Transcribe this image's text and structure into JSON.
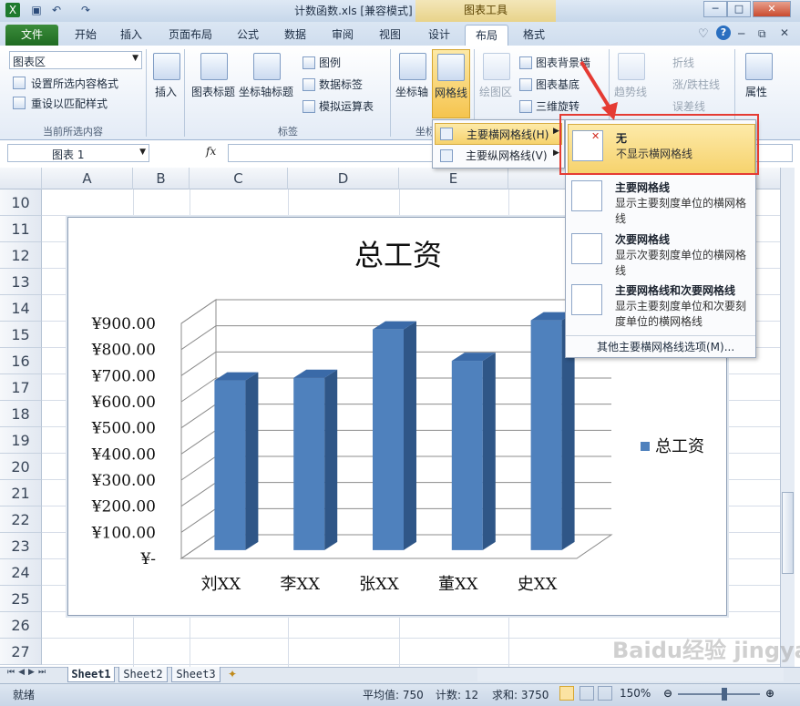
{
  "window": {
    "title": "计数函数.xls  [兼容模式]  -  Microsoft Excel",
    "context_tab": "图表工具",
    "min": "─",
    "max": "□",
    "close": "✕"
  },
  "tabs": [
    "文件",
    "开始",
    "插入",
    "页面布局",
    "公式",
    "数据",
    "审阅",
    "视图",
    "设计",
    "布局",
    "格式"
  ],
  "ribbon": {
    "current_selection": {
      "dropdown": "图表区",
      "format_selection": "设置所选内容格式",
      "reset_style": "重设以匹配样式",
      "group_label": "当前所选内容"
    },
    "insert": "插入",
    "labels_group": {
      "chart_title": "图表标题",
      "axis_titles": "坐标轴标题",
      "legend": "图例",
      "data_labels": "数据标签",
      "data_table": "模拟运算表",
      "group_label": "标签"
    },
    "axes_group": {
      "axes": "坐标轴",
      "gridlines": "网格线",
      "group_label": "坐标"
    },
    "background_group": {
      "plot_area": "绘图区",
      "chart_wall": "图表背景墙",
      "chart_floor": "图表基底",
      "rotation": "三维旋转"
    },
    "analysis_group": {
      "trendline": "趋势线",
      "lines": "折线",
      "updown_bars": "涨/跌柱线",
      "error_bars": "误差线"
    },
    "properties": "属性"
  },
  "formula_bar": {
    "name_box": "图表 1",
    "fx": "fx"
  },
  "columns": [
    "A",
    "B",
    "C",
    "D",
    "E"
  ],
  "rows": [
    "10",
    "11",
    "12",
    "13",
    "14",
    "15",
    "16",
    "17",
    "18",
    "19",
    "20",
    "21",
    "22",
    "23",
    "24",
    "25",
    "26",
    "27"
  ],
  "chart_data": {
    "type": "bar",
    "title": "总工资",
    "categories": [
      "刘XX",
      "李XX",
      "张XX",
      "董XX",
      "史XX"
    ],
    "series": [
      {
        "name": "总工资",
        "values": [
          650,
          660,
          845,
          725,
          880
        ]
      }
    ],
    "ylim": [
      0,
      900
    ],
    "y_tick_labels": [
      "¥-",
      "¥100.00",
      "¥200.00",
      "¥300.00",
      "¥400.00",
      "¥500.00",
      "¥600.00",
      "¥700.00",
      "¥800.00",
      "¥900.00"
    ],
    "grid": true,
    "legend_position": "right",
    "bar_color": "#4f81bd",
    "style": "3d-column"
  },
  "menu1": {
    "items": [
      "主要横网格线(H)",
      "主要纵网格线(V)"
    ]
  },
  "menu2": {
    "items": [
      {
        "title": "无",
        "desc": "不显示横网格线"
      },
      {
        "title": "主要网格线",
        "desc": "显示主要刻度单位的横网格线"
      },
      {
        "title": "次要网格线",
        "desc": "显示次要刻度单位的横网格线"
      },
      {
        "title": "主要网格线和次要网格线",
        "desc": "显示主要刻度单位和次要刻度单位的横网格线"
      }
    ],
    "more": "其他主要横网格线选项(M)..."
  },
  "sheets": [
    "Sheet1",
    "Sheet2",
    "Sheet3"
  ],
  "status": {
    "ready": "就绪",
    "average": "平均值: 750",
    "count": "计数: 12",
    "sum": "求和: 3750",
    "zoom": "150%"
  },
  "watermark": "Baidu经验 jingyan.baidu.com"
}
